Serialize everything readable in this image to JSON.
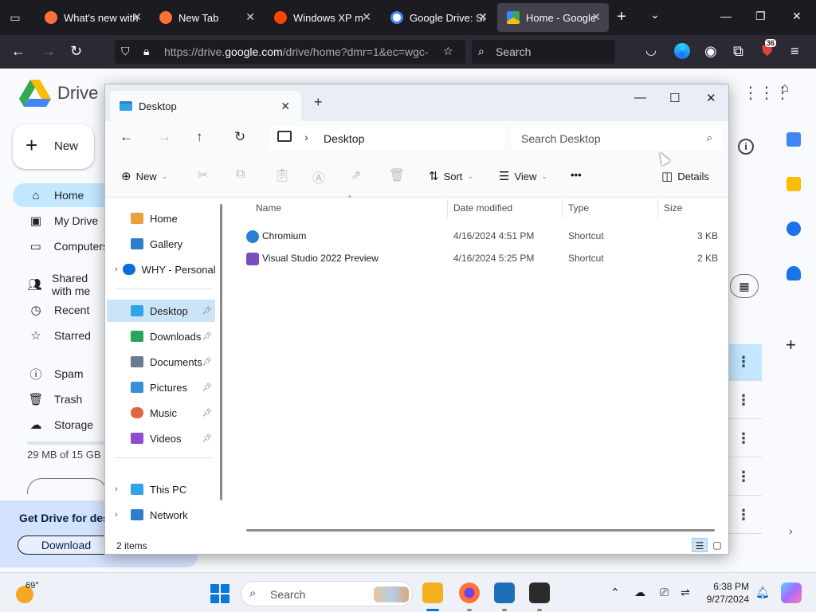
{
  "browser": {
    "tabs": [
      {
        "label": "What's new with",
        "favicon_color": "#ff7139"
      },
      {
        "label": "New Tab",
        "favicon_color": "#ff7139"
      },
      {
        "label": "Windows XP m",
        "favicon_color": "#ff4500"
      },
      {
        "label": "Google Drive: Si",
        "favicon_color": "#4285f4"
      },
      {
        "label": "Home - Google",
        "favicon_color": "#34a853"
      }
    ],
    "url_host_prefix": "https://drive.",
    "url_host": "google.com",
    "url_rest": "/drive/home?dmr=1&ec=wgc-",
    "search_placeholder": "Search",
    "extension_badge": "36"
  },
  "drive": {
    "app_name": "Drive",
    "new_label": "New",
    "nav": [
      {
        "label": "Home",
        "icon": "home-icon",
        "active": true
      },
      {
        "label": "My Drive",
        "icon": "my-drive-icon"
      },
      {
        "label": "Computers",
        "icon": "computers-icon"
      },
      {
        "label": "Shared with me",
        "icon": "shared-icon"
      },
      {
        "label": "Recent",
        "icon": "recent-icon"
      },
      {
        "label": "Starred",
        "icon": "star-icon"
      },
      {
        "label": "Spam",
        "icon": "spam-icon"
      },
      {
        "label": "Trash",
        "icon": "trash-icon"
      },
      {
        "label": "Storage",
        "icon": "cloud-icon"
      }
    ],
    "storage_text": "29 MB of 15 GB",
    "promo_text": "Get Drive for desktop",
    "promo_button": "Download"
  },
  "explorer": {
    "tab_title": "Desktop",
    "breadcrumb": "Desktop",
    "search_placeholder": "Search Desktop",
    "commands": {
      "new": "New",
      "sort": "Sort",
      "view": "View",
      "more": "•••",
      "details": "Details"
    },
    "nav_pane": [
      {
        "label": "Home",
        "icon_color": "#e9a23b",
        "group": "top"
      },
      {
        "label": "Gallery",
        "icon_color": "#2c7ec8",
        "group": "top"
      },
      {
        "label": "WHY - Personal",
        "icon_color": "#0a6fd6",
        "group": "top",
        "expandable": true
      },
      {
        "label": "Desktop",
        "icon_color": "#2fa5e8",
        "group": "quick",
        "pinned": true,
        "active": true
      },
      {
        "label": "Downloads",
        "icon_color": "#28a55f",
        "group": "quick",
        "pinned": true
      },
      {
        "label": "Documents",
        "icon_color": "#6b7b8c",
        "group": "quick",
        "pinned": true
      },
      {
        "label": "Pictures",
        "icon_color": "#3a8fd9",
        "group": "quick",
        "pinned": true
      },
      {
        "label": "Music",
        "icon_color": "#e0663c",
        "group": "quick",
        "pinned": true
      },
      {
        "label": "Videos",
        "icon_color": "#8e4ccf",
        "group": "quick",
        "pinned": true
      },
      {
        "label": "This PC",
        "icon_color": "#2fa5e8",
        "group": "bottom",
        "expandable": true
      },
      {
        "label": "Network",
        "icon_color": "#2c7ec8",
        "group": "bottom",
        "expandable": true
      }
    ],
    "columns": [
      "Name",
      "Date modified",
      "Type",
      "Size"
    ],
    "files": [
      {
        "name": "Chromium",
        "date": "4/16/2024 4:51 PM",
        "type": "Shortcut",
        "size": "3 KB",
        "icon_color": "#2d7fd3"
      },
      {
        "name": "Visual Studio 2022 Preview",
        "date": "4/16/2024 5:25 PM",
        "type": "Shortcut",
        "size": "2 KB",
        "icon_color": "#7a4cc0"
      }
    ],
    "status": "2 items"
  },
  "taskbar": {
    "temperature": "69°",
    "search_placeholder": "Search",
    "time": "6:38 PM",
    "date": "9/27/2024",
    "apps": [
      {
        "name": "file-explorer",
        "color": "#f2b01e",
        "active": true
      },
      {
        "name": "firefox",
        "color": "#ff7139"
      },
      {
        "name": "photos",
        "color": "#1f6fb8"
      },
      {
        "name": "terminal",
        "color": "#2b2b2b"
      }
    ]
  }
}
